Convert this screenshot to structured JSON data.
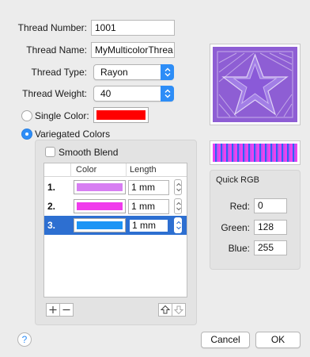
{
  "form": {
    "thread_number_label": "Thread Number:",
    "thread_number_value": "1001",
    "thread_name_label": "Thread Name:",
    "thread_name_value": "MyMulticolorThrea",
    "thread_type_label": "Thread Type:",
    "thread_type_value": "Rayon",
    "thread_weight_label": "Thread Weight:",
    "thread_weight_value": "40",
    "single_color_label": "Single Color:",
    "single_color_swatch": "#ff0000",
    "variegated_label": "Variegated Colors"
  },
  "variegated": {
    "smooth_blend_label": "Smooth Blend",
    "col_color": "Color",
    "col_length": "Length",
    "rows": [
      {
        "num": "1.",
        "color": "#d77ef2",
        "length": "1 mm"
      },
      {
        "num": "2.",
        "color": "#f03bec",
        "length": "1 mm"
      },
      {
        "num": "3.",
        "color": "#1d95f5",
        "length": "1 mm"
      }
    ],
    "add_icon": "plus-icon",
    "remove_icon": "minus-icon",
    "move_up_icon": "arrow-up-icon",
    "move_down_icon": "arrow-down-icon"
  },
  "quick_rgb": {
    "title": "Quick RGB",
    "red_label": "Red:",
    "red_value": "0",
    "green_label": "Green:",
    "green_value": "128",
    "blue_label": "Blue:",
    "blue_value": "255"
  },
  "footer": {
    "help_label": "?",
    "cancel_label": "Cancel",
    "ok_label": "OK"
  },
  "colors": {
    "accent": "#2d8df7",
    "selection": "#2d6fd1",
    "preview_purple": "#8e5ed4",
    "preview_pink": "#ec42f0"
  }
}
